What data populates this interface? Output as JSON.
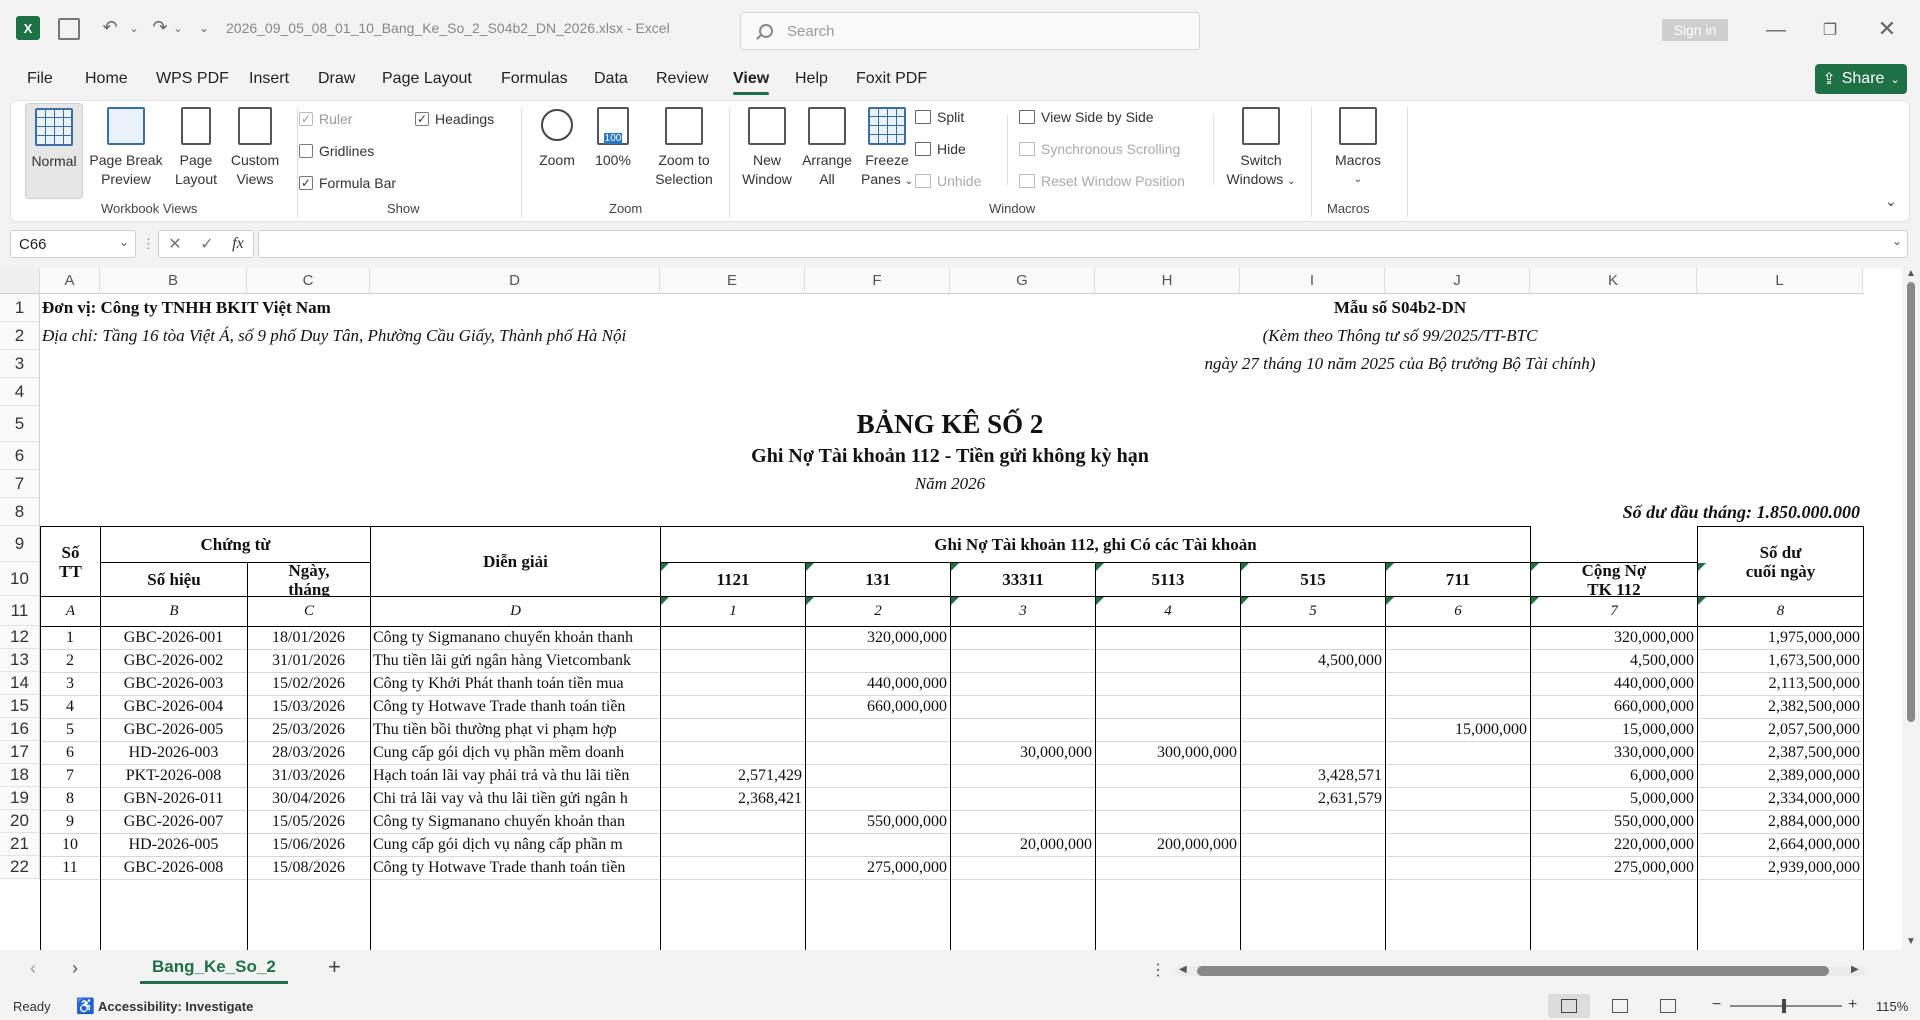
{
  "titlebar": {
    "filename": "2026_09_05_08_01_10_Bang_Ke_So_2_S04b2_DN_2026.xlsx - Excel",
    "search_placeholder": "Search",
    "signin": "Sign in"
  },
  "menu": [
    "File",
    "Home",
    "WPS PDF",
    "Insert",
    "Draw",
    "Page Layout",
    "Formulas",
    "Data",
    "Review",
    "View",
    "Help",
    "Foxit PDF"
  ],
  "share": "Share",
  "ribbon": {
    "workbook_views": {
      "label": "Workbook Views",
      "normal": "Normal",
      "page_break_1": "Page Break",
      "page_break_2": "Preview",
      "page_layout_1": "Page",
      "page_layout_2": "Layout",
      "custom_1": "Custom",
      "custom_2": "Views"
    },
    "show": {
      "label": "Show",
      "ruler": "Ruler",
      "gridlines": "Gridlines",
      "formula_bar": "Formula Bar",
      "headings": "Headings",
      "ruler_check": "✓",
      "formula_check": "✓",
      "headings_check": "✓"
    },
    "zoom": {
      "label": "Zoom",
      "zoom": "Zoom",
      "hundred": "100%",
      "sel_1": "Zoom to",
      "sel_2": "Selection",
      "badge": "100"
    },
    "window": {
      "label": "Window",
      "new_1": "New",
      "new_2": "Window",
      "arrange_1": "Arrange",
      "arrange_2": "All",
      "freeze_1": "Freeze",
      "freeze_2": "Panes",
      "split": "Split",
      "hide": "Hide",
      "unhide": "Unhide",
      "side": "View Side by Side",
      "sync": "Synchronous Scrolling",
      "reset": "Reset Window Position",
      "switch_1": "Switch",
      "switch_2": "Windows"
    },
    "macros": {
      "label": "Macros",
      "macros": "Macros"
    }
  },
  "formula_bar": {
    "name_box": "C66",
    "fx": "fx",
    "value": ""
  },
  "columns": [
    "A",
    "B",
    "C",
    "D",
    "E",
    "F",
    "G",
    "H",
    "I",
    "J",
    "K",
    "L"
  ],
  "rows": [
    "1",
    "2",
    "3",
    "4",
    "5",
    "6",
    "7",
    "8",
    "9",
    "10",
    "11",
    "12",
    "13",
    "14",
    "15",
    "16",
    "17",
    "18",
    "19",
    "20",
    "21",
    "22"
  ],
  "doc": {
    "unit": "Đơn vị: Công ty TNHH BKIT Việt Nam",
    "address": "Địa chỉ: Tầng 16 tòa Việt Á, số 9 phố Duy Tân, Phường Cầu Giấy, Thành phố Hà Nội",
    "form_no": "Mẫu số S04b2-DN",
    "circular": "(Kèm theo Thông tư số 99/2025/TT-BTC",
    "circular_date": "ngày 27 tháng 10 năm 2025 của Bộ trưởng Bộ Tài chính)",
    "title": "BẢNG KÊ SỐ 2",
    "subtitle": "Ghi Nợ Tài khoản 112 - Tiền gửi không kỳ hạn",
    "year": "Năm 2026",
    "opening_balance": "Số dư đầu tháng: 1.850.000.000"
  },
  "table_header": {
    "stt_1": "Số",
    "stt_2": "TT",
    "voucher": "Chứng từ",
    "voucher_no": "Số hiệu",
    "voucher_date_1": "Ngày,",
    "voucher_date_2": "tháng",
    "description": "Diễn giải",
    "debit_group": "Ghi Nợ Tài khoản 112, ghi Có các Tài khoản",
    "accounts": [
      "1121",
      "131",
      "33311",
      "5113",
      "515",
      "711"
    ],
    "total_1": "Cộng Nợ",
    "total_2": "TK 112",
    "balance_1": "Số dư",
    "balance_2": "cuối ngày",
    "codes": [
      "A",
      "B",
      "C",
      "D",
      "1",
      "2",
      "3",
      "4",
      "5",
      "6",
      "7",
      "8"
    ]
  },
  "table_rows": [
    [
      "1",
      "GBC-2026-001",
      "18/01/2026",
      "Công ty Sigmanano chuyển khoản thanh",
      "",
      "320,000,000",
      "",
      "",
      "",
      "",
      "320,000,000",
      "1,975,000,000"
    ],
    [
      "2",
      "GBC-2026-002",
      "31/01/2026",
      "Thu tiền lãi gửi ngân hàng Vietcombank",
      "",
      "",
      "",
      "",
      "4,500,000",
      "",
      "4,500,000",
      "1,673,500,000"
    ],
    [
      "3",
      "GBC-2026-003",
      "15/02/2026",
      "Công ty Khởi Phát thanh toán tiền mua",
      "",
      "440,000,000",
      "",
      "",
      "",
      "",
      "440,000,000",
      "2,113,500,000"
    ],
    [
      "4",
      "GBC-2026-004",
      "15/03/2026",
      "Công ty Hotwave Trade thanh toán tiền",
      "",
      "660,000,000",
      "",
      "",
      "",
      "",
      "660,000,000",
      "2,382,500,000"
    ],
    [
      "5",
      "GBC-2026-005",
      "25/03/2026",
      "Thu tiền bồi thường phạt vi phạm hợp",
      "",
      "",
      "",
      "",
      "",
      "15,000,000",
      "15,000,000",
      "2,057,500,000"
    ],
    [
      "6",
      "HD-2026-003",
      "28/03/2026",
      "Cung cấp gói dịch vụ phần mềm doanh",
      "",
      "",
      "30,000,000",
      "300,000,000",
      "",
      "",
      "330,000,000",
      "2,387,500,000"
    ],
    [
      "7",
      "PKT-2026-008",
      "31/03/2026",
      "Hạch toán lãi vay phải trả và thu lãi tiền",
      "2,571,429",
      "",
      "",
      "",
      "3,428,571",
      "",
      "6,000,000",
      "2,389,000,000"
    ],
    [
      "8",
      "GBN-2026-011",
      "30/04/2026",
      "Chi trả lãi vay và thu lãi tiền gửi ngân h",
      "2,368,421",
      "",
      "",
      "",
      "2,631,579",
      "",
      "5,000,000",
      "2,334,000,000"
    ],
    [
      "9",
      "GBC-2026-007",
      "15/05/2026",
      "Công ty Sigmanano chuyển khoản than",
      "",
      "550,000,000",
      "",
      "",
      "",
      "",
      "550,000,000",
      "2,884,000,000"
    ],
    [
      "10",
      "HD-2026-005",
      "15/06/2026",
      "Cung cấp gói dịch vụ nâng cấp phần m",
      "",
      "",
      "20,000,000",
      "200,000,000",
      "",
      "",
      "220,000,000",
      "2,664,000,000"
    ],
    [
      "11",
      "GBC-2026-008",
      "15/08/2026",
      "Công ty Hotwave Trade thanh toán tiền",
      "",
      "275,000,000",
      "",
      "",
      "",
      "",
      "275,000,000",
      "2,939,000,000"
    ]
  ],
  "sheet_tab": "Bang_Ke_So_2",
  "status": {
    "ready": "Ready",
    "accessibility": "Accessibility: Investigate",
    "zoom": "115%"
  }
}
